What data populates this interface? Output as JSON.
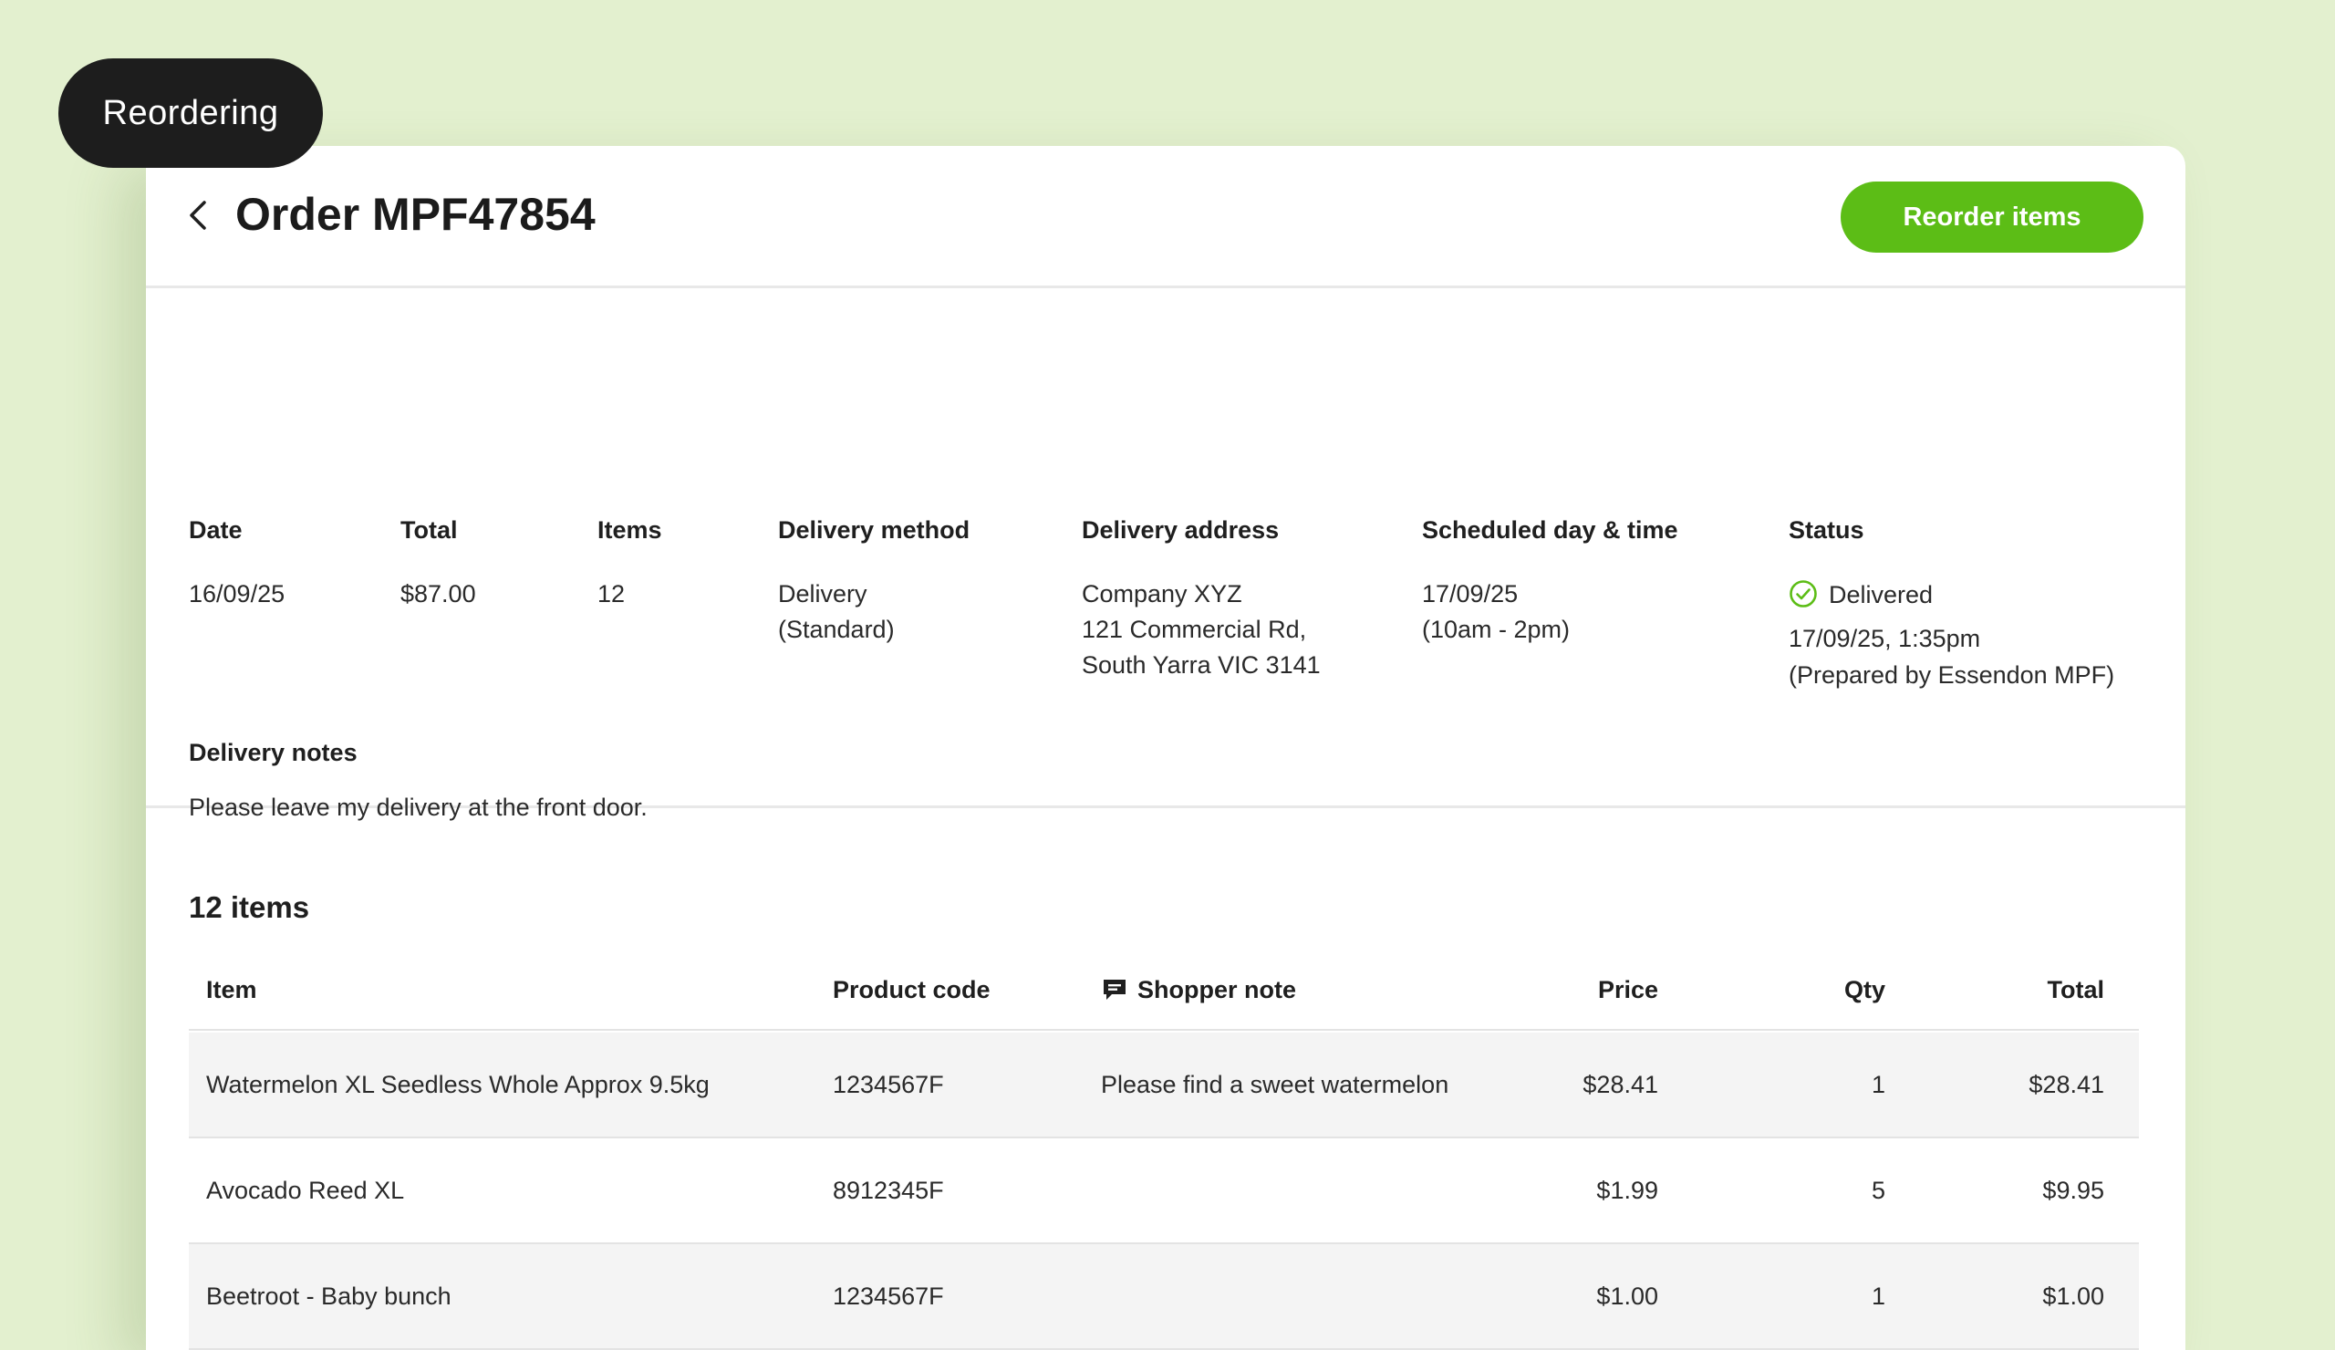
{
  "badge": "Reordering",
  "header": {
    "title": "Order MPF47854",
    "reorder_button": "Reorder items"
  },
  "summary": {
    "date": {
      "label": "Date",
      "value": "16/09/25"
    },
    "total": {
      "label": "Total",
      "value": "$87.00"
    },
    "items": {
      "label": "Items",
      "value": "12"
    },
    "delivery_method": {
      "label": "Delivery method",
      "line1": "Delivery",
      "line2": "(Standard)"
    },
    "delivery_address": {
      "label": "Delivery address",
      "line1": "Company XYZ",
      "line2": "121 Commercial Rd,",
      "line3": "South Yarra VIC 3141"
    },
    "scheduled": {
      "label": "Scheduled day & time",
      "line1": "17/09/25",
      "line2": "(10am - 2pm)"
    },
    "status": {
      "label": "Status",
      "value": "Delivered",
      "line2": "17/09/25, 1:35pm",
      "line3": "(Prepared by Essendon MPF)",
      "icon": "check-circle-icon",
      "color": "#5cbd16"
    }
  },
  "notes": {
    "label": "Delivery notes",
    "value": "Please leave my delivery at the front door."
  },
  "items_section": {
    "title": "12 items",
    "columns": {
      "item": "Item",
      "code": "Product code",
      "note": "Shopper note",
      "price": "Price",
      "qty": "Qty",
      "total": "Total"
    },
    "rows": [
      {
        "item": "Watermelon XL Seedless Whole Approx 9.5kg",
        "code": "1234567F",
        "note": "Please find a sweet watermelon",
        "price": "$28.41",
        "qty": "1",
        "total": "$28.41"
      },
      {
        "item": "Avocado Reed XL",
        "code": "8912345F",
        "note": "",
        "price": "$1.99",
        "qty": "5",
        "total": "$9.95"
      },
      {
        "item": "Beetroot - Baby bunch",
        "code": "1234567F",
        "note": "",
        "price": "$1.00",
        "qty": "1",
        "total": "$1.00"
      }
    ]
  },
  "colors": {
    "accent": "#5cbd16",
    "background": "#e3f0cf",
    "badge": "#1d1d1d"
  }
}
